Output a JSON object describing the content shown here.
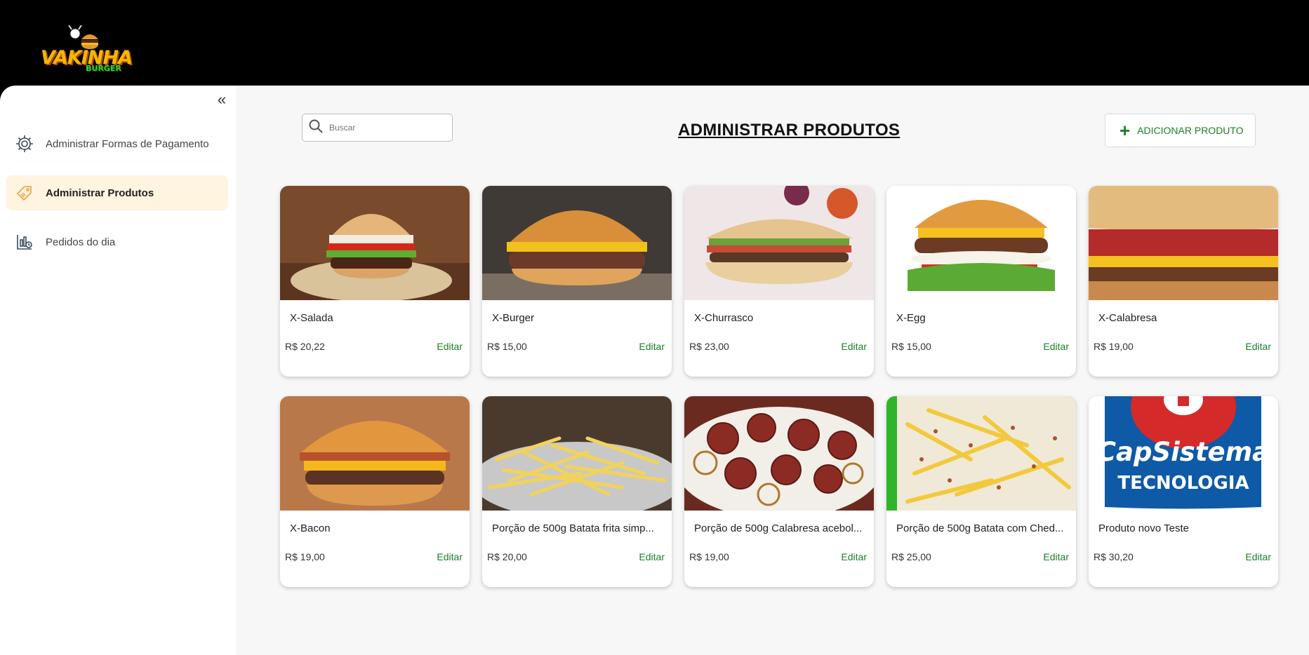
{
  "header": {
    "logo_text": "VAKINHA",
    "logo_sub": "BURGER"
  },
  "sidebar": {
    "items": [
      {
        "label": "Administrar Formas de Pagamento",
        "icon": "settings-gear-icon",
        "active": false
      },
      {
        "label": "Administrar Produtos",
        "icon": "price-tag-icon",
        "active": true
      },
      {
        "label": "Pedidos do dia",
        "icon": "orders-chart-icon",
        "active": false
      }
    ]
  },
  "search": {
    "placeholder": "Buscar"
  },
  "page_title": "ADMINISTRAR PRODUTOS",
  "add_button": {
    "label": "ADICIONAR PRODUTO"
  },
  "products": [
    {
      "name": "X-Salada",
      "price": "R$ 20,22",
      "action": "Editar"
    },
    {
      "name": "X-Burger",
      "price": "R$ 15,00",
      "action": "Editar"
    },
    {
      "name": "X-Churrasco",
      "price": "R$ 23,00",
      "action": "Editar"
    },
    {
      "name": "X-Egg",
      "price": "R$ 15,00",
      "action": "Editar"
    },
    {
      "name": "X-Calabresa",
      "price": "R$ 19,00",
      "action": "Editar"
    },
    {
      "name": "X-Bacon",
      "price": "R$ 19,00",
      "action": "Editar"
    },
    {
      "name": "Porção de 500g Batata frita simp...",
      "price": "R$ 20,00",
      "action": "Editar"
    },
    {
      "name": "Porção de 500g Calabresa acebol...",
      "price": "R$ 19,00",
      "action": "Editar"
    },
    {
      "name": "Porção de 500g Batata com Ched...",
      "price": "R$ 25,00",
      "action": "Editar"
    },
    {
      "name": "Produto novo Teste",
      "price": "R$ 30,20",
      "action": "Editar"
    }
  ],
  "product_image_brand": {
    "line1": "CapSistema",
    "line2": "TECNOLOGIA"
  },
  "colors": {
    "accent_green": "#1b7f27",
    "active_nav_bg": "#fff4e0",
    "topbar": "#000000"
  }
}
